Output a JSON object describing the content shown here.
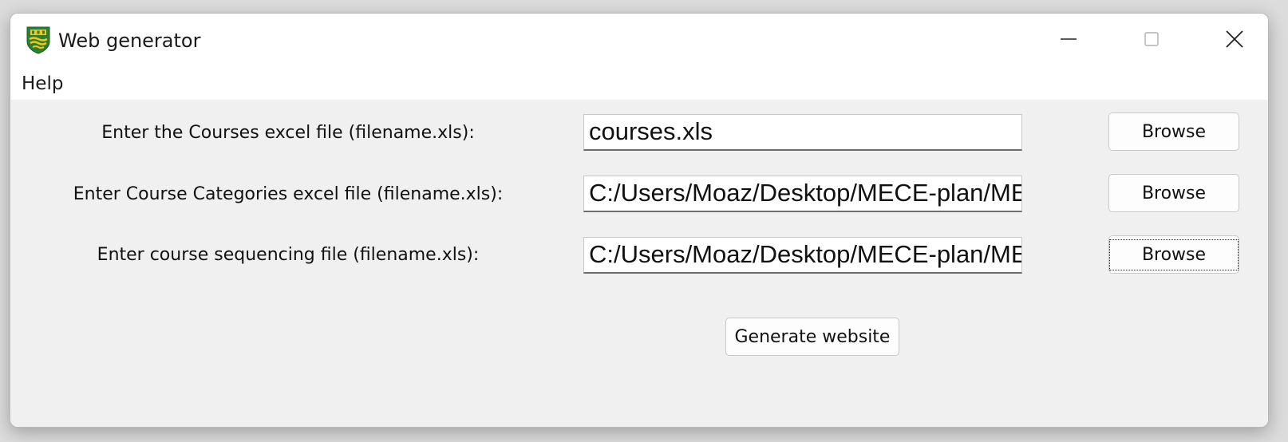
{
  "window": {
    "title": "Web generator",
    "icon": "university-crest-icon"
  },
  "menu": {
    "items": [
      {
        "label": "Help"
      }
    ]
  },
  "rows": [
    {
      "label": "Enter the Courses excel file (filename.xls):",
      "value": "courses.xls",
      "browse_label": "Browse"
    },
    {
      "label": "Enter Course Categories excel file (filename.xls):",
      "value": "C:/Users/Moaz/Desktop/MECE-plan/MECE-course-categories.xls",
      "browse_label": "Browse"
    },
    {
      "label": "Enter course sequencing file (filename.xls):",
      "value": "C:/Users/Moaz/Desktop/MECE-plan/MECE-course-sequencing.xls",
      "browse_label": "Browse"
    }
  ],
  "actions": {
    "generate_label": "Generate website"
  },
  "colors": {
    "window_bg": "#f0f0f0",
    "titlebar_bg": "#ffffff",
    "crest_green": "#2e7d32",
    "crest_gold": "#f5c518"
  }
}
